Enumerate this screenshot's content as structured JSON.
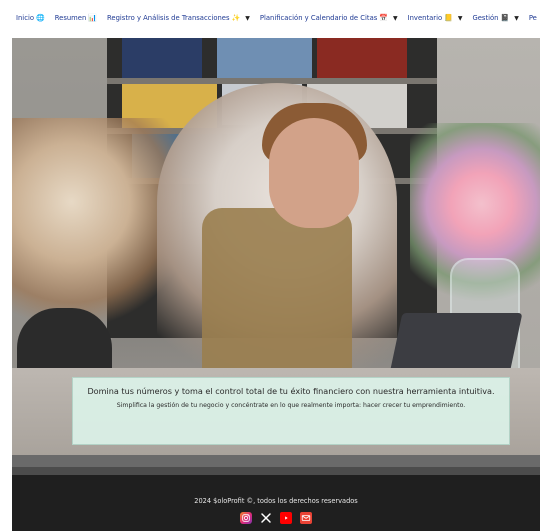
{
  "nav": {
    "items": [
      {
        "label": "Inicio",
        "emoji": "🌐",
        "has_caret": false
      },
      {
        "label": "Resumen",
        "emoji": "📊",
        "has_caret": false
      },
      {
        "label": "Registro y Análisis de Transacciones",
        "emoji": "✨",
        "has_caret": true
      },
      {
        "label": "Planificación y Calendario de Citas",
        "emoji": "📅",
        "has_caret": true
      },
      {
        "label": "Inventario",
        "emoji": "📒",
        "has_caret": true
      },
      {
        "label": "Gestión",
        "emoji": "📓",
        "has_caret": true
      },
      {
        "label": "Pe",
        "emoji": "",
        "has_caret": false
      }
    ]
  },
  "hero": {
    "headline": "Domina tus números y toma el control total de tu éxito financiero con nuestra herramienta intuitiva.",
    "subheadline": "Simplifica la gestión de tu negocio y concéntrate en lo que realmente importa: hacer crecer tu emprendimiento."
  },
  "footer": {
    "copyright": "2024 $oloProfit ©, todos los derechos reservados",
    "social": [
      {
        "name": "instagram-icon"
      },
      {
        "name": "x-icon"
      },
      {
        "name": "youtube-icon"
      },
      {
        "name": "mail-icon"
      }
    ]
  },
  "colors": {
    "nav_text": "#1f3a93",
    "overlay_bg": "#dbf2e8",
    "footer_bg": "#1f1f1f"
  }
}
